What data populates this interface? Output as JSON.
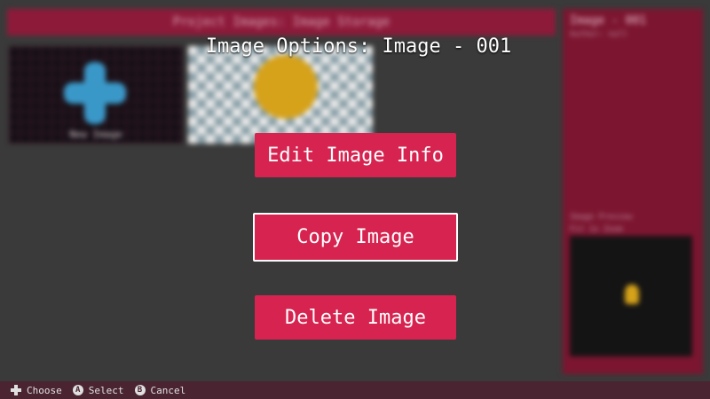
{
  "background": {
    "header_title": "Project Images: Image Storage",
    "new_image_label": "New Image",
    "side_panel": {
      "title": "Image - 001",
      "subtitle": "Author: null",
      "preview_label": "Image Preview",
      "preview_options": "Fit   1x   Zoom"
    }
  },
  "modal": {
    "title": "Image Options: Image - 001",
    "options": [
      {
        "label": "Edit Image Info"
      },
      {
        "label": "Copy Image"
      },
      {
        "label": "Delete Image"
      }
    ],
    "selected_index": 1
  },
  "footer": {
    "hints": [
      {
        "icon": "dpad-icon",
        "label": "Choose"
      },
      {
        "icon": "a-button-icon",
        "glyph": "A",
        "label": "Select"
      },
      {
        "icon": "b-button-icon",
        "glyph": "B",
        "label": "Cancel"
      }
    ]
  },
  "colors": {
    "accent": "#d6234f",
    "panel": "#7c1530",
    "background": "#3a3a3a",
    "footer": "#4a2430"
  }
}
